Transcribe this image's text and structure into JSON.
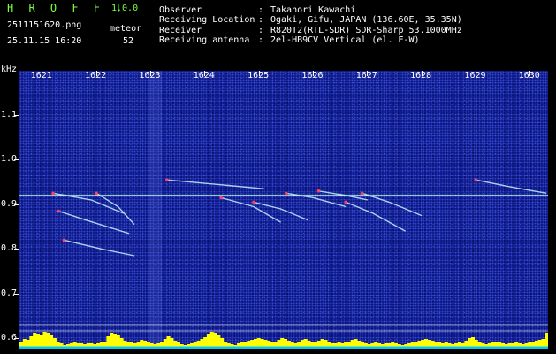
{
  "header": {
    "app_name": "H R O F F T",
    "app_version": "1.0.0",
    "filename": "2511151620.png",
    "datetime": "25.11.15 16:20",
    "detect_label": "meteor",
    "detect_count": "52",
    "rows": [
      {
        "label": "Observer",
        "sep": ":",
        "value": "Takanori Kawachi"
      },
      {
        "label": "Receiving Location",
        "sep": ":",
        "value": "Ogaki, Gifu, JAPAN (136.60E, 35.35N)"
      },
      {
        "label": "Receiver",
        "sep": ":",
        "value": "R820T2(RTL-SDR) SDR-Sharp 53.1000MHz"
      },
      {
        "label": "Receiving antenna",
        "sep": ":",
        "value": "2el-HB9CV Vertical (el. E-W)"
      }
    ]
  },
  "colors": {
    "background": "#000000",
    "spectrogram": "#0f1a8c",
    "carrier": "#b8ffd8",
    "trail": "#c8f0ff",
    "hot": "#ff4060",
    "bar": "#ffff00",
    "floor": "#00c8ff",
    "app_name": "#7fff3f"
  },
  "chart_data": {
    "type": "heatmap",
    "ylabel": "kHz",
    "x_ticks": [
      "1621",
      "1622",
      "1623",
      "1624",
      "1625",
      "1626",
      "1627",
      "1628",
      "1629",
      "1630"
    ],
    "y_ticks": [
      "1.1",
      "1.0",
      "0.9",
      "0.8",
      "0.7",
      "0.6"
    ],
    "xlim": [
      1620.58,
      1630.33
    ],
    "ylim": [
      0.577,
      1.199
    ],
    "y_scale": "linear",
    "carrier_khz": 0.92,
    "meteor_trails": [
      {
        "x": [
          1621.2,
          1621.9,
          1622.5
        ],
        "y": [
          0.925,
          0.91,
          0.88
        ]
      },
      {
        "x": [
          1621.3,
          1621.8,
          1622.6
        ],
        "y": [
          0.885,
          0.865,
          0.835
        ]
      },
      {
        "x": [
          1621.4,
          1622.1,
          1622.7
        ],
        "y": [
          0.82,
          0.8,
          0.785
        ]
      },
      {
        "x": [
          1622.0,
          1622.4,
          1622.7
        ],
        "y": [
          0.925,
          0.895,
          0.855
        ]
      },
      {
        "x": [
          1623.3,
          1624.2,
          1625.1
        ],
        "y": [
          0.955,
          0.945,
          0.935
        ]
      },
      {
        "x": [
          1624.3,
          1624.9,
          1625.4
        ],
        "y": [
          0.915,
          0.895,
          0.86
        ]
      },
      {
        "x": [
          1624.9,
          1625.4,
          1625.9
        ],
        "y": [
          0.905,
          0.89,
          0.865
        ]
      },
      {
        "x": [
          1625.5,
          1626.0,
          1626.6
        ],
        "y": [
          0.925,
          0.915,
          0.895
        ]
      },
      {
        "x": [
          1626.6,
          1627.1,
          1627.7
        ],
        "y": [
          0.905,
          0.88,
          0.84
        ]
      },
      {
        "x": [
          1626.9,
          1627.4,
          1628.0
        ],
        "y": [
          0.925,
          0.905,
          0.875
        ]
      },
      {
        "x": [
          1626.1,
          1626.6,
          1627.0
        ],
        "y": [
          0.93,
          0.92,
          0.91
        ]
      },
      {
        "x": [
          1629.0,
          1629.6,
          1630.3
        ],
        "y": [
          0.955,
          0.94,
          0.925
        ]
      }
    ],
    "signal_bars": [
      0.35,
      0.55,
      0.5,
      0.7,
      0.9,
      0.85,
      0.8,
      0.95,
      0.9,
      0.75,
      0.6,
      0.4,
      0.3,
      0.2,
      0.25,
      0.3,
      0.35,
      0.3,
      0.3,
      0.25,
      0.3,
      0.3,
      0.25,
      0.3,
      0.35,
      0.4,
      0.7,
      0.9,
      0.85,
      0.75,
      0.6,
      0.45,
      0.4,
      0.35,
      0.3,
      0.4,
      0.5,
      0.45,
      0.35,
      0.3,
      0.25,
      0.3,
      0.35,
      0.55,
      0.7,
      0.6,
      0.45,
      0.35,
      0.25,
      0.2,
      0.25,
      0.3,
      0.35,
      0.45,
      0.55,
      0.65,
      0.85,
      0.95,
      0.9,
      0.8,
      0.6,
      0.35,
      0.3,
      0.25,
      0.2,
      0.3,
      0.35,
      0.4,
      0.45,
      0.5,
      0.55,
      0.6,
      0.55,
      0.5,
      0.45,
      0.4,
      0.35,
      0.5,
      0.6,
      0.55,
      0.45,
      0.35,
      0.3,
      0.35,
      0.5,
      0.55,
      0.45,
      0.35,
      0.35,
      0.45,
      0.55,
      0.5,
      0.4,
      0.3,
      0.3,
      0.35,
      0.3,
      0.35,
      0.4,
      0.5,
      0.55,
      0.45,
      0.35,
      0.3,
      0.25,
      0.3,
      0.35,
      0.3,
      0.25,
      0.3,
      0.3,
      0.35,
      0.3,
      0.25,
      0.2,
      0.25,
      0.3,
      0.35,
      0.4,
      0.45,
      0.5,
      0.55,
      0.5,
      0.45,
      0.4,
      0.35,
      0.3,
      0.35,
      0.3,
      0.25,
      0.3,
      0.35,
      0.3,
      0.45,
      0.6,
      0.65,
      0.5,
      0.35,
      0.3,
      0.25,
      0.3,
      0.35,
      0.4,
      0.35,
      0.3,
      0.25,
      0.3,
      0.3,
      0.35,
      0.3,
      0.25,
      0.3,
      0.35,
      0.4,
      0.45,
      0.5,
      0.55,
      0.9
    ]
  }
}
